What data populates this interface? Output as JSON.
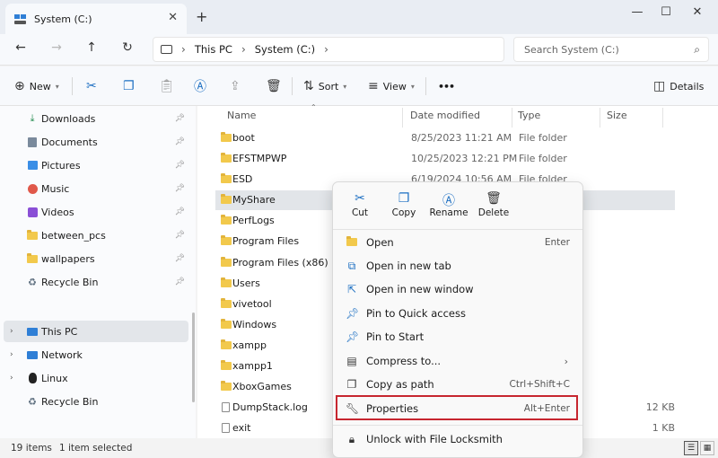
{
  "window": {
    "tab_title": "System (C:)",
    "tab_close": "✕",
    "new_tab": "+",
    "minimize": "—",
    "maximize": "☐",
    "close": "✕"
  },
  "address": {
    "back": "←",
    "forward": "→",
    "up": "↑",
    "refresh": "↻",
    "breadcrumb": [
      "This PC",
      "System (C:)"
    ],
    "separator": "›",
    "search_placeholder": "Search System (C:)"
  },
  "commands": {
    "new": "New",
    "sort": "Sort",
    "view": "View",
    "more": "•••",
    "details": "Details"
  },
  "sidebar": {
    "items": [
      {
        "label": "Downloads",
        "icon": "download-icon"
      },
      {
        "label": "Documents",
        "icon": "documents-icon"
      },
      {
        "label": "Pictures",
        "icon": "pictures-icon"
      },
      {
        "label": "Music",
        "icon": "music-icon"
      },
      {
        "label": "Videos",
        "icon": "videos-icon"
      },
      {
        "label": "between_pcs",
        "icon": "folder-icon"
      },
      {
        "label": "wallpapers",
        "icon": "folder-icon"
      },
      {
        "label": "Recycle Bin",
        "icon": "recycle-bin-icon"
      },
      {
        "label": "This PC",
        "icon": "computer-icon"
      },
      {
        "label": "Network",
        "icon": "network-icon"
      },
      {
        "label": "Linux",
        "icon": "linux-icon"
      },
      {
        "label": "Recycle Bin",
        "icon": "recycle-bin-icon"
      }
    ]
  },
  "columns": {
    "name": "Name",
    "date": "Date modified",
    "type": "Type",
    "size": "Size"
  },
  "files": [
    {
      "name": "boot",
      "date": "8/25/2023 11:21 AM",
      "type": "File folder",
      "size": ""
    },
    {
      "name": "EFSTMPWP",
      "date": "10/25/2023 12:21 PM",
      "type": "File folder",
      "size": ""
    },
    {
      "name": "ESD",
      "date": "6/19/2024 10:56 AM",
      "type": "File folder",
      "size": ""
    },
    {
      "name": "MyShare",
      "date": "",
      "type": "",
      "size": ""
    },
    {
      "name": "PerfLogs",
      "date": "",
      "type": "",
      "size": ""
    },
    {
      "name": "Program Files",
      "date": "",
      "type": "",
      "size": ""
    },
    {
      "name": "Program Files (x86)",
      "date": "",
      "type": "",
      "size": ""
    },
    {
      "name": "Users",
      "date": "",
      "type": "",
      "size": ""
    },
    {
      "name": "vivetool",
      "date": "",
      "type": "",
      "size": ""
    },
    {
      "name": "Windows",
      "date": "",
      "type": "",
      "size": ""
    },
    {
      "name": "xampp",
      "date": "",
      "type": "",
      "size": ""
    },
    {
      "name": "xampp1",
      "date": "",
      "type": "",
      "size": ""
    },
    {
      "name": "XboxGames",
      "date": "",
      "type": "",
      "size": ""
    },
    {
      "name": "DumpStack.log",
      "date": "",
      "type": "",
      "size": "12 KB"
    },
    {
      "name": "exit",
      "date": "",
      "type": "",
      "size": "1 KB"
    }
  ],
  "status": {
    "item_count": "19 items",
    "selected": "1 item selected"
  },
  "context_menu": {
    "quick_actions": [
      {
        "label": "Cut",
        "icon": "scissors-icon"
      },
      {
        "label": "Copy",
        "icon": "copy-icon"
      },
      {
        "label": "Rename",
        "icon": "rename-icon"
      },
      {
        "label": "Delete",
        "icon": "trash-icon"
      }
    ],
    "items": [
      {
        "label": "Open",
        "shortcut": "Enter"
      },
      {
        "label": "Open in new tab",
        "shortcut": ""
      },
      {
        "label": "Open in new window",
        "shortcut": ""
      },
      {
        "label": "Pin to Quick access",
        "shortcut": ""
      },
      {
        "label": "Pin to Start",
        "shortcut": ""
      },
      {
        "label": "Compress to...",
        "shortcut": ""
      },
      {
        "label": "Copy as path",
        "shortcut": "Ctrl+Shift+C"
      },
      {
        "label": "Properties",
        "shortcut": "Alt+Enter"
      },
      {
        "label": "Unlock with File Locksmith",
        "shortcut": ""
      }
    ],
    "highlight_color": "#c7262f"
  }
}
